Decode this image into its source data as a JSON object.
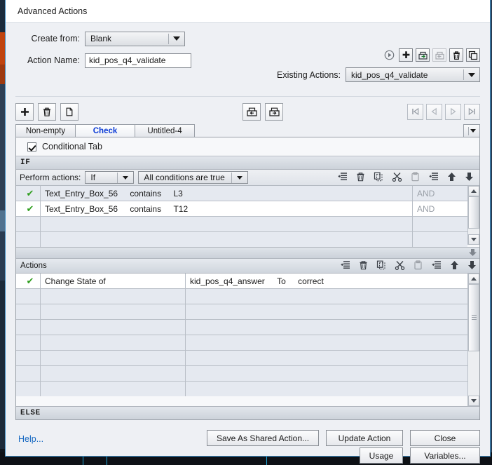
{
  "window": {
    "title": "Advanced Actions"
  },
  "header": {
    "create_from_label": "Create from:",
    "create_from_value": "Blank",
    "action_name_label": "Action Name:",
    "action_name_value": "kid_pos_q4_validate",
    "existing_actions_label": "Existing Actions:",
    "existing_actions_value": "kid_pos_q4_validate",
    "icons": [
      {
        "name": "preview-icon",
        "glyph": "▶"
      },
      {
        "name": "add-icon",
        "glyph": "＋"
      },
      {
        "name": "export-icon",
        "glyph": "→"
      },
      {
        "name": "import-icon",
        "glyph": "←"
      },
      {
        "name": "delete-icon",
        "glyph": "🗑"
      },
      {
        "name": "duplicate-icon",
        "glyph": "❐"
      }
    ]
  },
  "toolbar": {
    "add_label": "+",
    "delete_label": "delete",
    "copy_label": "copy",
    "import_label": "import",
    "export_label": "export",
    "nav_first": "first",
    "nav_prev": "previous",
    "nav_next": "next",
    "nav_last": "last"
  },
  "tabs": [
    {
      "label": "Non-empty",
      "active": false
    },
    {
      "label": "Check",
      "active": true
    },
    {
      "label": "Untitled-4",
      "active": false
    }
  ],
  "conditional_tab": {
    "label": "Conditional Tab",
    "checked": true
  },
  "if_section": {
    "header": "IF",
    "perform_label": "Perform actions:",
    "perform_value": "If",
    "match_value": "All conditions are true",
    "rows": [
      {
        "enabled": true,
        "object": "Text_Entry_Box_56",
        "operator": "contains",
        "value": "L3",
        "join": "AND"
      },
      {
        "enabled": true,
        "object": "Text_Entry_Box_56",
        "operator": "contains",
        "value": "T12",
        "join": "AND"
      },
      {
        "enabled": false,
        "object": "",
        "operator": "",
        "value": "",
        "join": ""
      },
      {
        "enabled": false,
        "object": "",
        "operator": "",
        "value": "",
        "join": ""
      }
    ]
  },
  "actions_section": {
    "header": "Actions",
    "rows": [
      {
        "enabled": true,
        "action": "Change State of",
        "target": "kid_pos_q4_answer",
        "to_label": "To",
        "state": "correct"
      },
      {
        "enabled": false,
        "action": "",
        "target": "",
        "to_label": "",
        "state": ""
      },
      {
        "enabled": false,
        "action": "",
        "target": "",
        "to_label": "",
        "state": ""
      },
      {
        "enabled": false,
        "action": "",
        "target": "",
        "to_label": "",
        "state": ""
      },
      {
        "enabled": false,
        "action": "",
        "target": "",
        "to_label": "",
        "state": ""
      },
      {
        "enabled": false,
        "action": "",
        "target": "",
        "to_label": "",
        "state": ""
      },
      {
        "enabled": false,
        "action": "",
        "target": "",
        "to_label": "",
        "state": ""
      },
      {
        "enabled": false,
        "action": "",
        "target": "",
        "to_label": "",
        "state": ""
      }
    ]
  },
  "else_section": {
    "header": "ELSE"
  },
  "footer": {
    "help_label": "Help...",
    "usage_label": "Usage",
    "variables_label": "Variables...",
    "save_shared_label": "Save As Shared Action...",
    "update_label": "Update Action",
    "close_label": "Close"
  },
  "colors": {
    "accent_blue": "#0a3ad6",
    "link_blue": "#1668c1",
    "tick_green": "#2f9e1f",
    "window_border": "#3f8ec4",
    "panel_bg": "#eef0f4"
  }
}
